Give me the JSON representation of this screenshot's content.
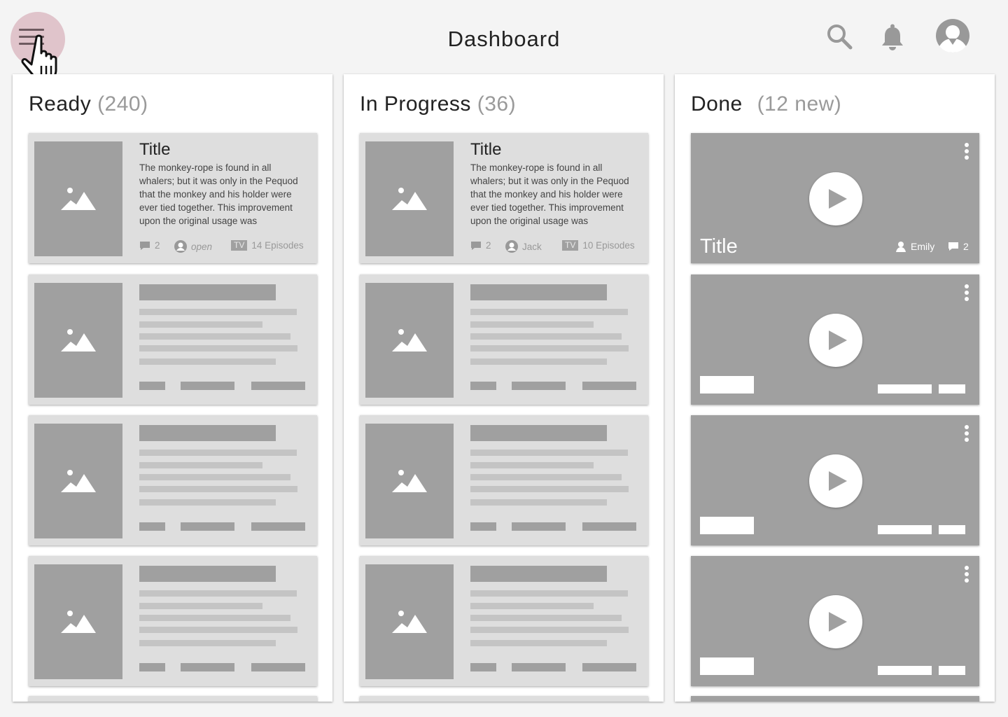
{
  "header": {
    "title": "Dashboard",
    "icons": [
      "menu-icon",
      "search-icon",
      "bell-icon",
      "user-avatar-icon"
    ]
  },
  "columns": [
    {
      "title": "Ready",
      "count": "(240)",
      "card": {
        "title": "Title",
        "description": "The monkey-rope is found in all whalers; but it was only in the Pequod that the monkey and his holder were ever tied together. This improvement upon the original usage was",
        "comments": "2",
        "assignee": "open",
        "badge": "TV",
        "episodes": "14 Episodes"
      }
    },
    {
      "title": "In Progress",
      "count": "(36)",
      "card": {
        "title": "Title",
        "description": "The monkey-rope is found in all whalers; but it was only in the Pequod that the monkey and his holder were ever tied together. This improvement upon the original usage was",
        "comments": "2",
        "assignee": "Jack",
        "badge": "TV",
        "episodes": "10 Episodes"
      }
    },
    {
      "title": "Done",
      "count": "(12 new)",
      "card": {
        "title": "Title",
        "assignee": "Emily",
        "comments": "2"
      }
    }
  ],
  "colors": {
    "background": "#f4f4f4",
    "placeholder": "#a0a0a0",
    "card": "#dedede",
    "menu_highlight": "#e0c4cb"
  }
}
